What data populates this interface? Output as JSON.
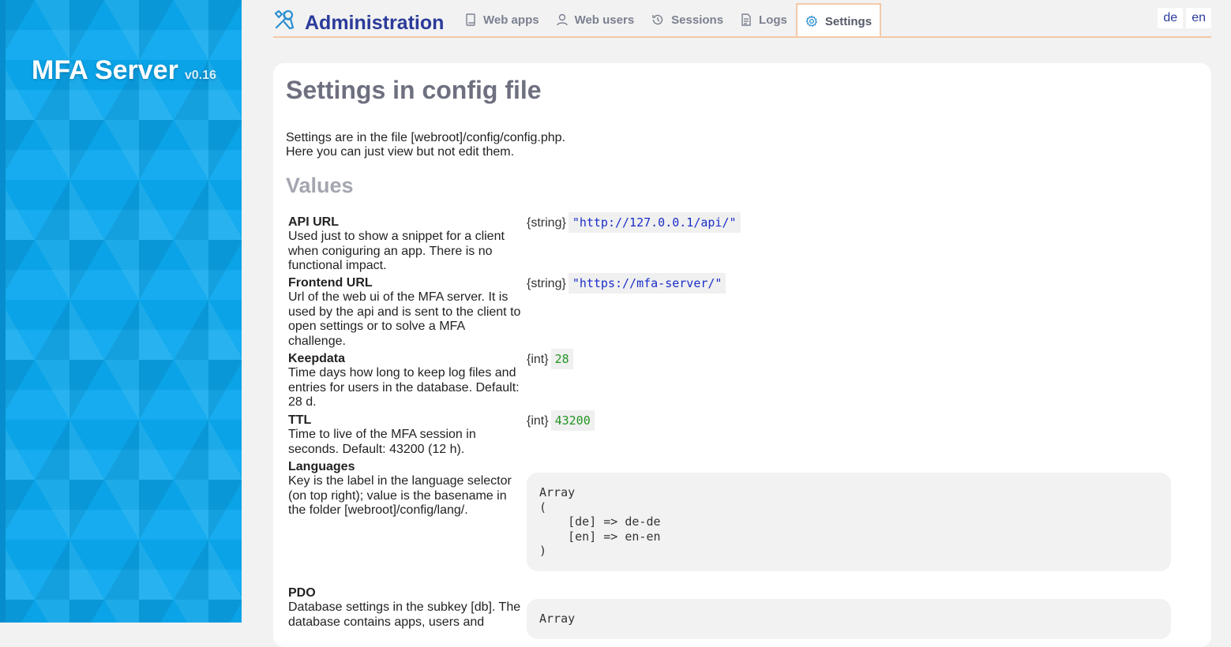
{
  "sidebar": {
    "app_name": "MFA Server",
    "version": "v0.16"
  },
  "header": {
    "title": "Administration",
    "tabs": [
      {
        "label": "Web apps",
        "icon": "book-icon"
      },
      {
        "label": "Web users",
        "icon": "user-icon"
      },
      {
        "label": "Sessions",
        "icon": "history-icon"
      },
      {
        "label": "Logs",
        "icon": "file-text-icon"
      },
      {
        "label": "Settings",
        "icon": "gear-icon",
        "active": true
      }
    ],
    "languages": [
      "de",
      "en"
    ]
  },
  "main": {
    "title": "Settings in config file",
    "intro_line1": "Settings are in the file [webroot]/config/config.php.",
    "intro_line2": "Here you can just view but not edit them.",
    "values_heading": "Values",
    "settings": [
      {
        "name": "API URL",
        "description": "Used just to show a snippet for a client when coniguring an app. There is no functional impact.",
        "type": "{string}",
        "value": "\"http://127.0.0.1/api/\""
      },
      {
        "name": "Frontend URL",
        "description": "Url of the web ui of the MFA server. It is used by the api and is sent to the client to open settings or to solve a MFA challenge.",
        "type": "{string}",
        "value": "\"https://mfa-server/\""
      },
      {
        "name": "Keepdata",
        "description": "Time days how long to keep log files and entries for users in the database. Default: 28 d.",
        "type": "{int}",
        "value": "28"
      },
      {
        "name": "TTL",
        "description": "Time to live of the MFA session in seconds. Default: 43200 (12 h).",
        "type": "{int}",
        "value": "43200"
      },
      {
        "name": "Languages",
        "description": "Key is the label in the language selector (on top right); value is the basename in the folder [webroot]/config/lang/.",
        "value": "Array\n(\n    [de] => de-de\n    [en] => en-en\n)"
      },
      {
        "name": "PDO",
        "description": "Database settings in the subkey [db]. The database contains  apps, users and",
        "value": "Array"
      }
    ]
  },
  "colors": {
    "sidebar": "#0aa8ee",
    "accent": "#2b3b9a",
    "tab_border": "#f3c9a8",
    "string_value": "#1a2ec9",
    "int_value": "#239423"
  }
}
